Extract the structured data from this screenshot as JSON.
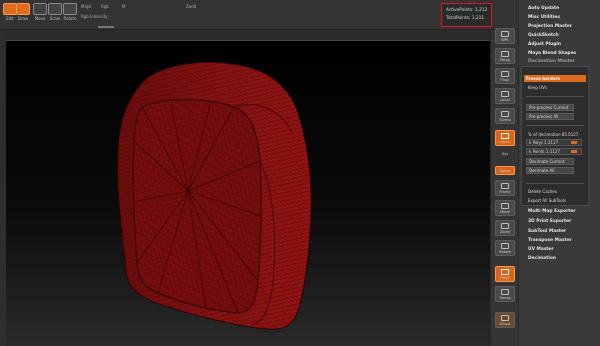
{
  "toolbar": {
    "buttons": [
      {
        "label": "Edit",
        "icon": "edit-icon",
        "active": true
      },
      {
        "label": "Draw",
        "icon": "draw-icon",
        "active": true
      },
      {
        "label": "Move",
        "icon": "move-icon",
        "active": false
      },
      {
        "label": "Scale",
        "icon": "scale-icon",
        "active": false
      },
      {
        "label": "Rotate",
        "icon": "rotate-icon",
        "active": false
      }
    ],
    "sliders": [
      {
        "label": "Mrgb",
        "fill": 0.5
      },
      {
        "label": "Rgb",
        "fill": 0.45
      },
      {
        "label": "M",
        "fill": 0.3
      },
      {
        "label": "Zadd",
        "fill": 0.35
      }
    ],
    "rgb_intensity_label": "Rgb Intensity"
  },
  "stats": {
    "active_points": "ActivePoints: 1,212",
    "total_points": "TotalPoints: 1,211"
  },
  "right_strip": {
    "buttons": [
      {
        "label": "BPR",
        "icon": "bpr-icon",
        "orange": false
      },
      {
        "label": "Persp",
        "icon": "perspective-icon",
        "orange": false
      },
      {
        "label": "Floor",
        "icon": "floor-icon",
        "orange": false
      },
      {
        "label": "Local",
        "icon": "local-icon",
        "orange": false
      },
      {
        "label": "Gizmo",
        "icon": "gizmo-icon",
        "orange": false
      },
      {
        "label": "Dyna",
        "icon": "dynamic-icon",
        "orange": true
      },
      {
        "label": "Frame",
        "icon": "frame-icon",
        "orange": false
      },
      {
        "label": "Move",
        "icon": "move-view-icon",
        "orange": false
      },
      {
        "label": "Zoom",
        "icon": "zoom-icon",
        "orange": false
      },
      {
        "label": "Rotate",
        "icon": "rotate-view-icon",
        "orange": false
      },
      {
        "label": "PolyF",
        "icon": "polyframe-icon",
        "orange": true
      },
      {
        "label": "Transp",
        "icon": "transparency-icon",
        "orange": false
      },
      {
        "label": "Ghost",
        "icon": "ghost-icon",
        "orange": false
      }
    ],
    "xyz_label": "Xyz",
    "xpose_label": "Xpose"
  },
  "plugins": {
    "items": [
      "Auto Update",
      "Misc Utilities",
      "Projection Master",
      "QuickSketch",
      "Adjust Plugin",
      "Maya Blend Shapes",
      "Decimation Master"
    ],
    "items_after": [
      "Multi Map Exporter",
      "3D Print Exporter",
      "SubTool Master",
      "Transpose Master",
      "UV Master",
      "Decimation"
    ]
  },
  "decimation": {
    "freeze_borders": "Freeze borders",
    "keep_uvs": "Keep UVs",
    "preprocess_current": "Pre-process Current",
    "preprocess_all": "Pre-process All",
    "percent_label": "% of decimation 85.0127",
    "k_polys": "k Polys 1.2117",
    "k_points": "k Points 1.1127",
    "decimate_current": "Decimate Current",
    "decimate_all": "Decimate All",
    "delete_caches": "Delete Caches",
    "export_all": "Export All SubTools"
  }
}
